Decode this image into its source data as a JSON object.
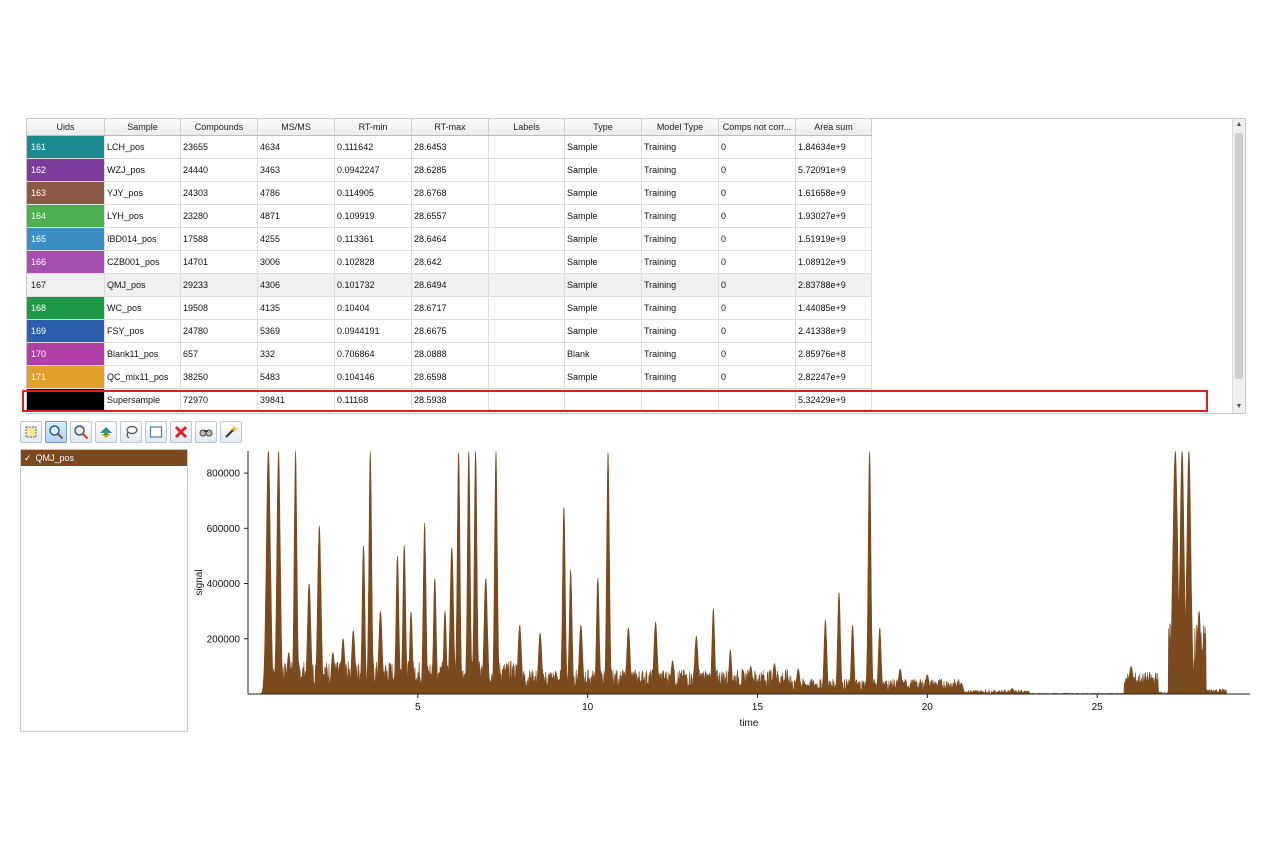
{
  "table": {
    "columns": [
      "Uids",
      "Sample",
      "Compounds",
      "MS/MS",
      "RT-min",
      "RT-max",
      "Labels",
      "Type",
      "Model Type",
      "Comps not corr...",
      "Area sum"
    ],
    "rows": [
      {
        "uid": "161",
        "color": "#1b8a93",
        "sample": "LCH_pos",
        "compounds": "23655",
        "msms": "4634",
        "rt_min": "0.111642",
        "rt_max": "28.6453",
        "labels": "",
        "type": "Sample",
        "model_type": "Training",
        "comps_not_corr": "0",
        "area_sum": "1.84634e+9"
      },
      {
        "uid": "162",
        "color": "#7b3c9c",
        "sample": "WZJ_pos",
        "compounds": "24440",
        "msms": "3463",
        "rt_min": "0.0942247",
        "rt_max": "28.6285",
        "labels": "",
        "type": "Sample",
        "model_type": "Training",
        "comps_not_corr": "0",
        "area_sum": "5.72091e+9"
      },
      {
        "uid": "163",
        "color": "#8b5a45",
        "sample": "YJY_pos",
        "compounds": "24303",
        "msms": "4786",
        "rt_min": "0.114905",
        "rt_max": "28.6768",
        "labels": "",
        "type": "Sample",
        "model_type": "Training",
        "comps_not_corr": "0",
        "area_sum": "1.61658e+9"
      },
      {
        "uid": "164",
        "color": "#4caf50",
        "sample": "LYH_pos",
        "compounds": "23280",
        "msms": "4871",
        "rt_min": "0.109919",
        "rt_max": "28.6557",
        "labels": "",
        "type": "Sample",
        "model_type": "Training",
        "comps_not_corr": "0",
        "area_sum": "1.93027e+9"
      },
      {
        "uid": "165",
        "color": "#3b8fc4",
        "sample": "IBD014_pos",
        "compounds": "17588",
        "msms": "4255",
        "rt_min": "0.113361",
        "rt_max": "28.6464",
        "labels": "",
        "type": "Sample",
        "model_type": "Training",
        "comps_not_corr": "0",
        "area_sum": "1.51919e+9"
      },
      {
        "uid": "166",
        "color": "#a74fb0",
        "sample": "CZB001_pos",
        "compounds": "14701",
        "msms": "3006",
        "rt_min": "0.102828",
        "rt_max": "28.642",
        "labels": "",
        "type": "Sample",
        "model_type": "Training",
        "comps_not_corr": "0",
        "area_sum": "1.08912e+9"
      },
      {
        "uid": "167",
        "color": "#f0f0f0",
        "sample": "QMJ_pos",
        "compounds": "29233",
        "msms": "4306",
        "rt_min": "0.101732",
        "rt_max": "28.6494",
        "labels": "",
        "type": "Sample",
        "model_type": "Training",
        "comps_not_corr": "0",
        "area_sum": "2.83788e+9"
      },
      {
        "uid": "168",
        "color": "#1e9a46",
        "sample": "WC_pos",
        "compounds": "19508",
        "msms": "4135",
        "rt_min": "0.10404",
        "rt_max": "28.6717",
        "labels": "",
        "type": "Sample",
        "model_type": "Training",
        "comps_not_corr": "0",
        "area_sum": "1.44085e+9"
      },
      {
        "uid": "169",
        "color": "#2b5fae",
        "sample": "FSY_pos",
        "compounds": "24780",
        "msms": "5369",
        "rt_min": "0.0944191",
        "rt_max": "28.6675",
        "labels": "",
        "type": "Sample",
        "model_type": "Training",
        "comps_not_corr": "0",
        "area_sum": "2.41338e+9"
      },
      {
        "uid": "170",
        "color": "#b03ea6",
        "sample": "Blank11_pos",
        "compounds": "657",
        "msms": "332",
        "rt_min": "0.706864",
        "rt_max": "28.0888",
        "labels": "",
        "type": "Blank",
        "model_type": "Training",
        "comps_not_corr": "0",
        "area_sum": "2.85976e+8"
      },
      {
        "uid": "171",
        "color": "#e0a02a",
        "sample": "QC_mix11_pos",
        "compounds": "38250",
        "msms": "5483",
        "rt_min": "0.104146",
        "rt_max": "28.6598",
        "labels": "",
        "type": "Sample",
        "model_type": "Training",
        "comps_not_corr": "0",
        "area_sum": "2.82247e+9"
      },
      {
        "uid": "",
        "color": "#000000",
        "sample": "Supersample",
        "compounds": "72970",
        "msms": "39841",
        "rt_min": "0.11168",
        "rt_max": "28.5938",
        "labels": "",
        "type": "",
        "model_type": "",
        "comps_not_corr": "",
        "area_sum": "5.32429e+9"
      }
    ]
  },
  "toolbar": {
    "icons": [
      "select-icon",
      "zoom-in-icon",
      "zoom-out-icon",
      "pan-icon",
      "lasso-icon",
      "rectangle-icon",
      "delete-icon",
      "view-icon",
      "magic-wand-icon"
    ]
  },
  "sample_list": {
    "items": [
      {
        "label": "QMJ_pos",
        "checked": true
      }
    ]
  },
  "chart_data": {
    "type": "line",
    "xlabel": "time",
    "ylabel": "signal",
    "xlim": [
      0,
      29.5
    ],
    "ylim": [
      0,
      880000
    ],
    "xticks": [
      5,
      10,
      15,
      20,
      25
    ],
    "yticks": [
      200000,
      400000,
      600000,
      800000
    ],
    "series": [
      {
        "color": "#7a4a1e"
      }
    ],
    "peaks": [
      [
        0.6,
        880000,
        0.06
      ],
      [
        0.9,
        880000,
        0.05
      ],
      [
        1.2,
        150000,
        0.05
      ],
      [
        1.4,
        880000,
        0.04
      ],
      [
        1.8,
        400000,
        0.05
      ],
      [
        2.1,
        610000,
        0.05
      ],
      [
        2.5,
        150000,
        0.05
      ],
      [
        2.8,
        200000,
        0.05
      ],
      [
        3.1,
        230000,
        0.05
      ],
      [
        3.4,
        540000,
        0.04
      ],
      [
        3.6,
        880000,
        0.04
      ],
      [
        3.9,
        300000,
        0.05
      ],
      [
        4.4,
        500000,
        0.04
      ],
      [
        4.6,
        540000,
        0.04
      ],
      [
        4.8,
        300000,
        0.04
      ],
      [
        5.2,
        620000,
        0.04
      ],
      [
        5.5,
        420000,
        0.04
      ],
      [
        5.8,
        300000,
        0.04
      ],
      [
        6.0,
        530000,
        0.05
      ],
      [
        6.2,
        880000,
        0.04
      ],
      [
        6.5,
        880000,
        0.04
      ],
      [
        6.7,
        880000,
        0.04
      ],
      [
        7.0,
        420000,
        0.05
      ],
      [
        7.3,
        880000,
        0.04
      ],
      [
        8.0,
        250000,
        0.05
      ],
      [
        8.6,
        220000,
        0.05
      ],
      [
        9.3,
        680000,
        0.04
      ],
      [
        9.5,
        450000,
        0.04
      ],
      [
        9.8,
        250000,
        0.05
      ],
      [
        10.3,
        420000,
        0.04
      ],
      [
        10.6,
        880000,
        0.04
      ],
      [
        11.2,
        240000,
        0.05
      ],
      [
        12.0,
        260000,
        0.05
      ],
      [
        12.5,
        120000,
        0.05
      ],
      [
        13.2,
        210000,
        0.05
      ],
      [
        13.7,
        310000,
        0.04
      ],
      [
        14.2,
        160000,
        0.04
      ],
      [
        14.8,
        100000,
        0.05
      ],
      [
        15.5,
        110000,
        0.05
      ],
      [
        16.2,
        90000,
        0.05
      ],
      [
        17.0,
        270000,
        0.04
      ],
      [
        17.4,
        370000,
        0.04
      ],
      [
        17.8,
        250000,
        0.04
      ],
      [
        18.3,
        880000,
        0.04
      ],
      [
        18.6,
        240000,
        0.04
      ],
      [
        19.2,
        90000,
        0.05
      ],
      [
        20.0,
        70000,
        0.05
      ],
      [
        21.0,
        40000,
        0.05
      ],
      [
        22.5,
        20000,
        0.05
      ],
      [
        26.0,
        100000,
        0.06
      ],
      [
        26.5,
        50000,
        0.06
      ],
      [
        27.3,
        880000,
        0.07
      ],
      [
        27.5,
        880000,
        0.06
      ],
      [
        27.7,
        880000,
        0.06
      ],
      [
        28.0,
        300000,
        0.05
      ]
    ]
  }
}
